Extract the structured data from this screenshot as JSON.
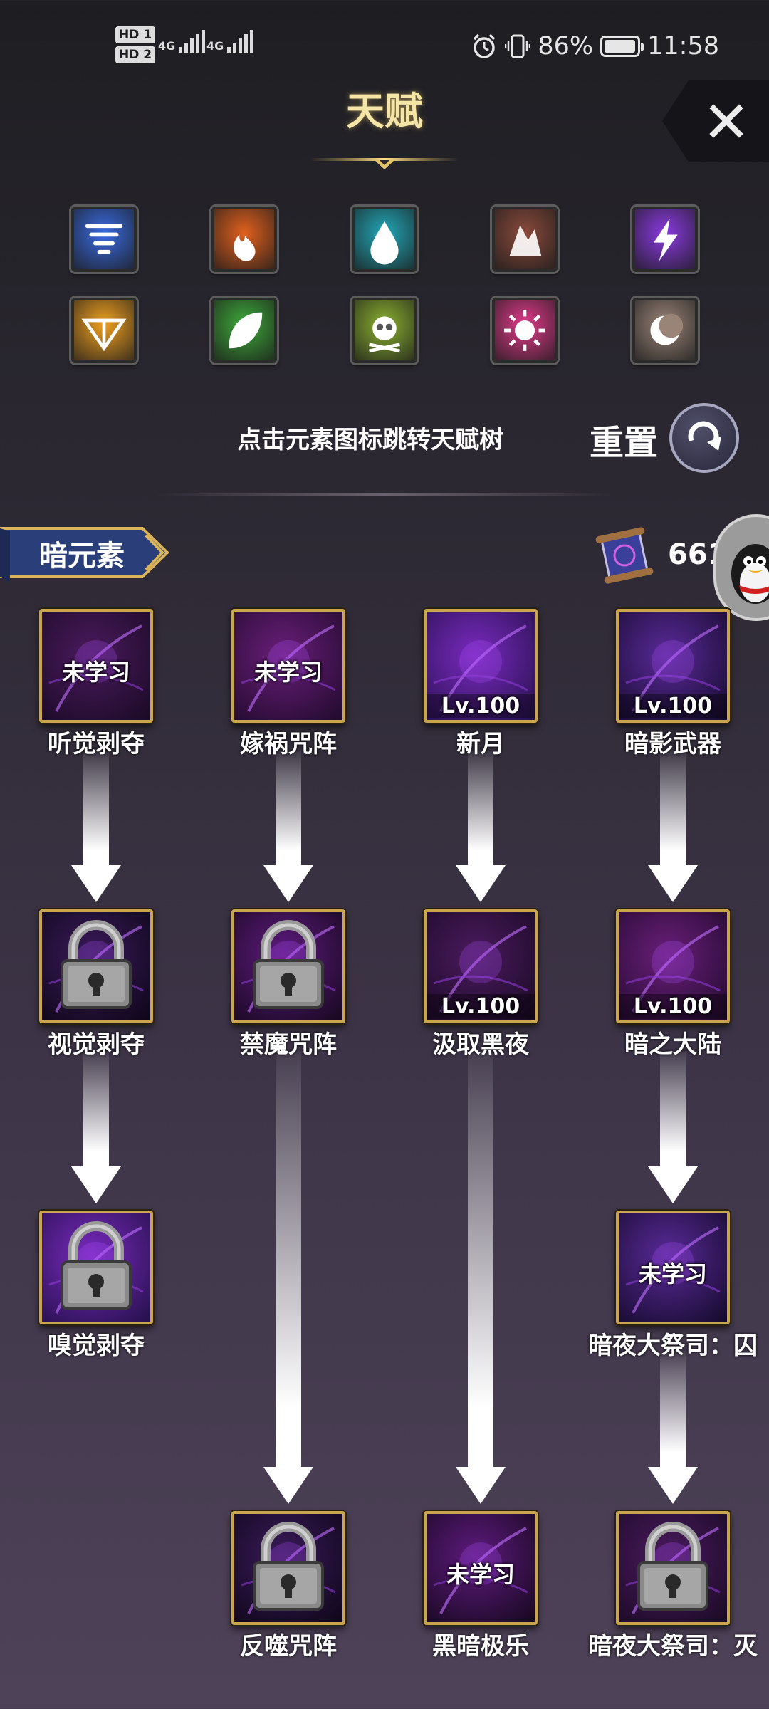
{
  "status_bar": {
    "sim1": "HD 1",
    "sim2": "HD 2",
    "net1": "4G",
    "net2": "4G",
    "battery_percent": "86%",
    "battery_level": 0.86,
    "time": "11:58",
    "icons": [
      "alarm-icon",
      "vibrate-icon",
      "battery-icon"
    ]
  },
  "header": {
    "title": "天赋",
    "close_icon": "close-icon"
  },
  "elements": [
    {
      "name": "wind",
      "color": "#3a6be0"
    },
    {
      "name": "fire",
      "color": "#e0601e"
    },
    {
      "name": "water",
      "color": "#22a8b8"
    },
    {
      "name": "earth",
      "color": "#8a4a3c"
    },
    {
      "name": "thunder",
      "color": "#8a3ae0"
    },
    {
      "name": "light",
      "color": "#f0a020"
    },
    {
      "name": "nature",
      "color": "#3ea83a"
    },
    {
      "name": "poison",
      "color": "#8ab030"
    },
    {
      "name": "holy",
      "color": "#e03a8a"
    },
    {
      "name": "moon",
      "color": "#9a8478"
    }
  ],
  "hint": "点击元素图标跳转天赋树",
  "reset": {
    "label": "重置",
    "icon": "reset-arrow-icon"
  },
  "element_tag": "暗元素",
  "currency": {
    "icon": "scroll-icon",
    "value": "6616"
  },
  "skills": [
    {
      "id": "s1",
      "name": "听觉剥夺",
      "state": "未学习"
    },
    {
      "id": "s2",
      "name": "嫁祸咒阵",
      "state": "未学习"
    },
    {
      "id": "s3",
      "name": "新月",
      "state": "Lv.100"
    },
    {
      "id": "s4",
      "name": "暗影武器",
      "state": "Lv.100"
    },
    {
      "id": "s5",
      "name": "视觉剥夺",
      "state": "locked"
    },
    {
      "id": "s6",
      "name": "禁魔咒阵",
      "state": "locked"
    },
    {
      "id": "s7",
      "name": "汲取黑夜",
      "state": "Lv.100"
    },
    {
      "id": "s8",
      "name": "暗之大陆",
      "state": "Lv.100"
    },
    {
      "id": "s9",
      "name": "嗅觉剥夺",
      "state": "locked"
    },
    {
      "id": "s10",
      "name": "暗夜大祭司：囚",
      "state": "未学习"
    },
    {
      "id": "s11",
      "name": "反噬咒阵",
      "state": "locked"
    },
    {
      "id": "s12",
      "name": "黑暗极乐",
      "state": "未学习"
    },
    {
      "id": "s13",
      "name": "暗夜大祭司：灭",
      "state": "locked"
    }
  ]
}
